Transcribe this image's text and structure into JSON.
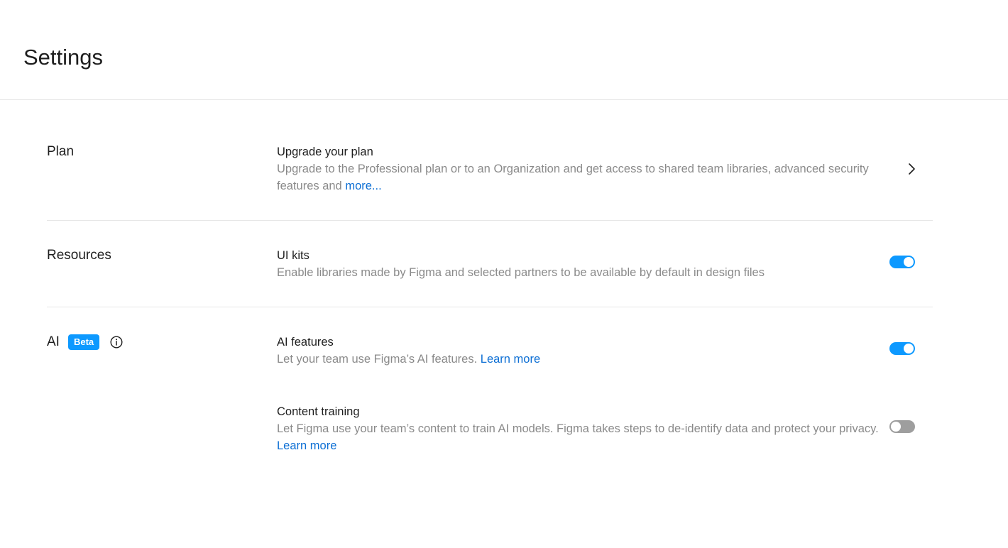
{
  "header": {
    "title": "Settings"
  },
  "sections": [
    {
      "title": "Plan",
      "settings": [
        {
          "title": "Upgrade your plan",
          "description": "Upgrade to the Professional plan or to an Organization and get access to shared team libraries, advanced security features and ",
          "link": "more...",
          "control": "chevron-right-icon"
        }
      ]
    },
    {
      "title": "Resources",
      "settings": [
        {
          "title": "UI kits",
          "description": "Enable libraries made by Figma and selected partners to be available by default in design files",
          "control": "toggle",
          "enabled": true
        }
      ]
    },
    {
      "title": "AI",
      "badge": "Beta",
      "icon": "info-icon",
      "settings": [
        {
          "title": "AI features",
          "description": "Let your team use Figma’s AI features. ",
          "link": "Learn more",
          "control": "toggle",
          "enabled": true
        },
        {
          "title": "Content training",
          "description": "Let Figma use your team’s content to train AI models. Figma takes steps to de-identify data and protect your privacy. ",
          "link": "Learn more",
          "control": "toggle",
          "enabled": false
        }
      ]
    }
  ],
  "colors": {
    "accent": "#0d99ff",
    "link": "#0d6fd4",
    "toggle_off": "#9e9e9e",
    "muted_text": "#8a8a8a"
  }
}
